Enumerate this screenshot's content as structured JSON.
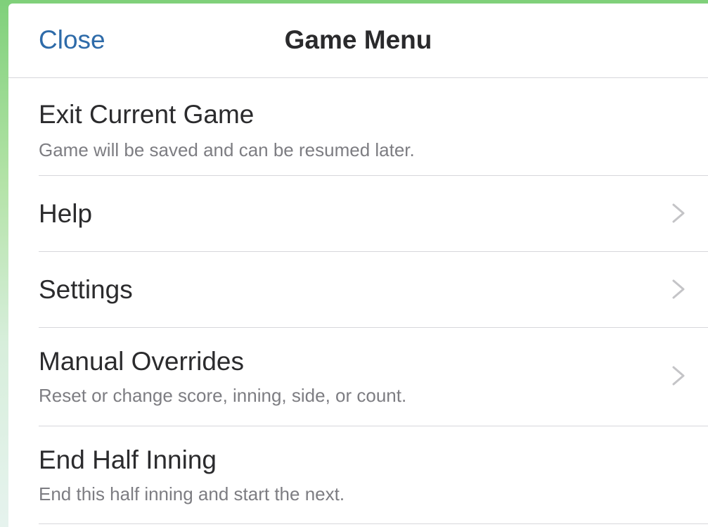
{
  "navbar": {
    "close_label": "Close",
    "title": "Game Menu"
  },
  "menu": {
    "items": [
      {
        "label": "Exit Current Game",
        "subtitle": "Game will be saved and can be resumed later.",
        "icon": null
      },
      {
        "label": "Help",
        "subtitle": "",
        "icon": "chevron-right-icon"
      },
      {
        "label": "Settings",
        "subtitle": "",
        "icon": "chevron-right-icon"
      },
      {
        "label": "Manual Overrides",
        "subtitle": "Reset or change score, inning, side, or count.",
        "icon": "chevron-right-icon"
      },
      {
        "label": "End Half Inning",
        "subtitle": "End this half inning and start the next.",
        "icon": null
      }
    ]
  },
  "colors": {
    "accent": "#2e6ba9",
    "background_green": "#7fd07a",
    "separator": "#d7d7db",
    "chevron": "#c4c4c7",
    "subtitle": "#7d7d82"
  }
}
